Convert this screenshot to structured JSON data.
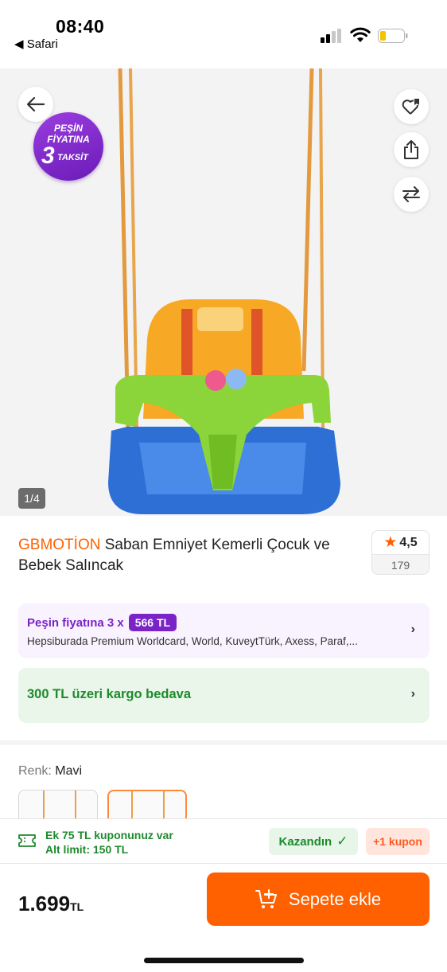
{
  "status_bar": {
    "time": "08:40",
    "back_app": "◀ Safari"
  },
  "gallery": {
    "badge": {
      "line1": "PEŞİN",
      "line2": "FİYATINA",
      "number": "3",
      "word": "TAKSİT"
    },
    "counter": "1/4",
    "icons": [
      "arrow-left-icon",
      "heart-list-icon",
      "share-icon",
      "compare-icon"
    ]
  },
  "product": {
    "brand": "GBMOTİON",
    "name": "Saban Emniyet Kemerli Çocuk ve Bebek Salıncak",
    "rating": "4,5",
    "review_count": "179"
  },
  "installment": {
    "prefix": "Peşin fiyatına 3 x",
    "amount": "566 TL",
    "banks": "Hepsiburada Premium Worldcard, World, KuveytTürk, Axess, Paraf,..."
  },
  "shipping": {
    "text": "300 TL üzeri kargo bedava"
  },
  "color": {
    "label": "Renk:",
    "value": "Mavi"
  },
  "coupon": {
    "line1": "Ek 75 TL kuponunuz var",
    "line2": "Alt limit: 150 TL",
    "won_label": "Kazandın",
    "more_label": "+1 kupon"
  },
  "bottom": {
    "price": "1.699",
    "currency": "TL",
    "cart_label": "Sepete ekle"
  },
  "colors": {
    "accent": "#ff6000",
    "purple": "#7a24c8",
    "green": "#1d8a2c"
  }
}
